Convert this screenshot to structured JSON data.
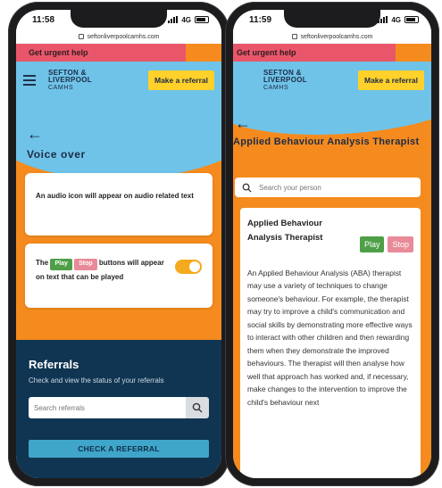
{
  "left_phone": {
    "status": {
      "time": "11:58",
      "network": "4G"
    },
    "url": "seftonliverpoolcamhs.com",
    "urgent_label": "Get urgent help",
    "logo": {
      "line1": "SEFTON &",
      "line2": "LIVERPOOL",
      "line3": "CAMHS"
    },
    "referral_button": "Make a referral",
    "back_arrow": "←",
    "section_title": "Voice over",
    "audio_card_text": "An audio icon will appear on audio related text",
    "buttons_card": {
      "prefix": "The",
      "play": "Play",
      "stop": "Stop",
      "suffix": "buttons will appear on text that can be played",
      "toggle_on": true
    },
    "referrals": {
      "title": "Referrals",
      "subtitle": "Check and view the status of your referrals",
      "search_placeholder": "Search referrals",
      "check_button": "CHECK A REFERRAL"
    }
  },
  "right_phone": {
    "status": {
      "time": "11:59",
      "network": "4G"
    },
    "url": "seftonliverpoolcamhs.com",
    "urgent_label": "Get urgent help",
    "logo": {
      "line1": "SEFTON &",
      "line2": "LIVERPOOL",
      "line3": "CAMHS"
    },
    "referral_button": "Make a referral",
    "back_arrow": "←",
    "page_title": "Applied Behaviour Analysis Therapist",
    "search_placeholder": "Search your person",
    "detail_name": "Applied Behaviour Analysis Therapist",
    "play": "Play",
    "stop": "Stop",
    "description": "An Applied Behaviour Analysis (ABA) therapist may use a variety of techniques to change someone's behaviour. For example, the therapist may try to improve a child's communication and social skills by demonstrating more effective ways to interact with other children and then rewarding them when they demonstrate the improved behaviours. The therapist will then analyse how well that approach has worked and, if necessary, make changes to the intervention to improve the child's behaviour next"
  },
  "colors": {
    "orange": "#f58b1e",
    "sky_blue": "#6fc3e8",
    "navy": "#0f3552",
    "urgent_red": "#e9566a",
    "yellow": "#ffd12a",
    "play_green": "#4e9f47",
    "stop_pink": "#e88a98"
  }
}
